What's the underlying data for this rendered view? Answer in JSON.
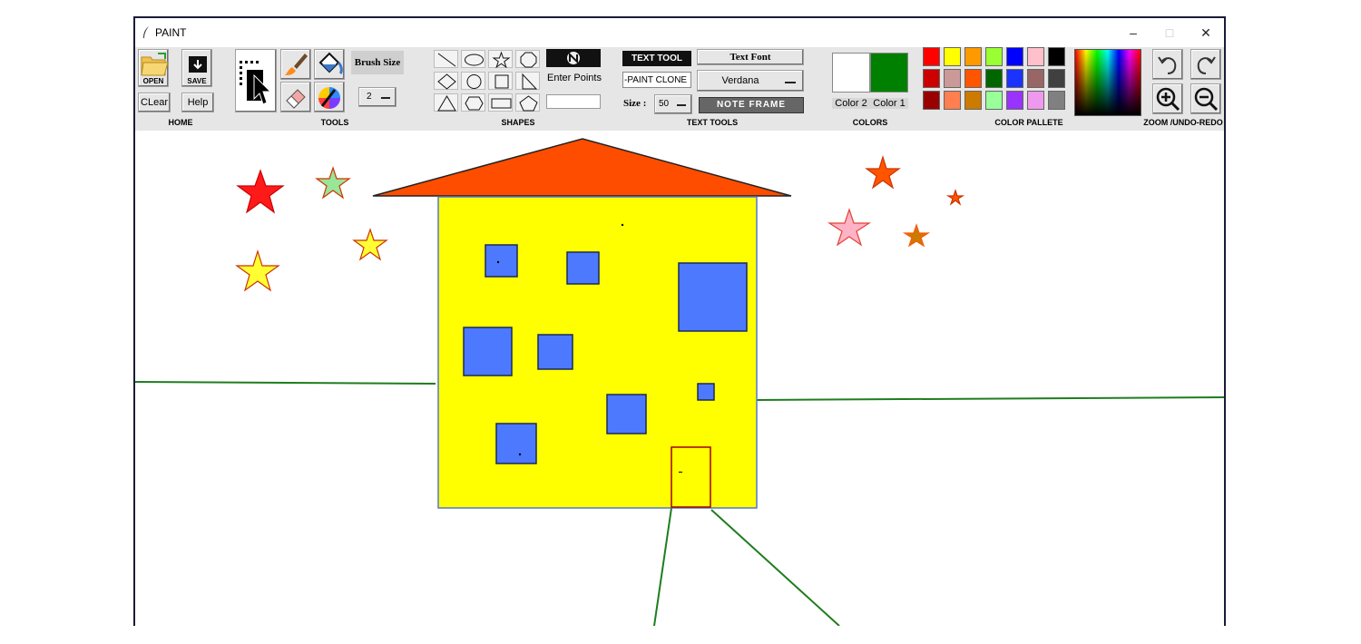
{
  "window": {
    "title": "PAINT",
    "controls": {
      "minimize": "–",
      "maximize": "□",
      "close": "✕"
    }
  },
  "home": {
    "open_label": "OPEN",
    "save_label": "SAVE",
    "clear_label": "CLear",
    "help_label": "Help",
    "group_label": "HOME"
  },
  "tools": {
    "group_label": "TOOLS",
    "brush_size_label": "Brush Size",
    "brush_size_value": "2",
    "items": [
      "select-icon",
      "brush-icon",
      "fill-bucket-icon",
      "eraser-icon",
      "color-picker-icon"
    ]
  },
  "shapes": {
    "group_label": "SHAPES",
    "items": [
      "line",
      "oval",
      "star",
      "octagon",
      "diamond",
      "circle",
      "square",
      "right-triangle",
      "triangle",
      "hexagon",
      "rectangle",
      "pentagon"
    ],
    "enter_points_label": "Enter Points",
    "points_value": ""
  },
  "text_tools": {
    "group_label": "TEXT TOOLS",
    "text_tool_label": "TEXT TOOL",
    "text_value": "-PAINT CLONE",
    "size_label": "Size :",
    "size_value": "50",
    "font_label": "Text Font",
    "font_value": "Verdana",
    "note_frame_label": "NOTE FRAME"
  },
  "colors": {
    "group_label": "COLORS",
    "color2_label": "Color 2",
    "color1_label": "Color 1",
    "color2": "#ffffff",
    "color1": "#008000"
  },
  "palette": {
    "group_label": "COLOR PALLETE",
    "swatches": [
      "#ff0000",
      "#ffff00",
      "#ff9900",
      "#99ff33",
      "#0000ff",
      "#ffc0cb",
      "#000000",
      "#cc0000",
      "#cc9999",
      "#ff5500",
      "#006600",
      "#1a33ff",
      "#996666",
      "#404040",
      "#990000",
      "#ff7f50",
      "#cc7a00",
      "#99ff99",
      "#9933ff",
      "#ee99ee",
      "#808080"
    ]
  },
  "zoom": {
    "group_label": "ZOOM /UNDO-REDO"
  },
  "drawing": {
    "house_wall": "#ffff00",
    "roof": "#ff4d00",
    "window_fill": "#4d79ff",
    "ground_line": "#008000",
    "door_border": "#a00000"
  }
}
